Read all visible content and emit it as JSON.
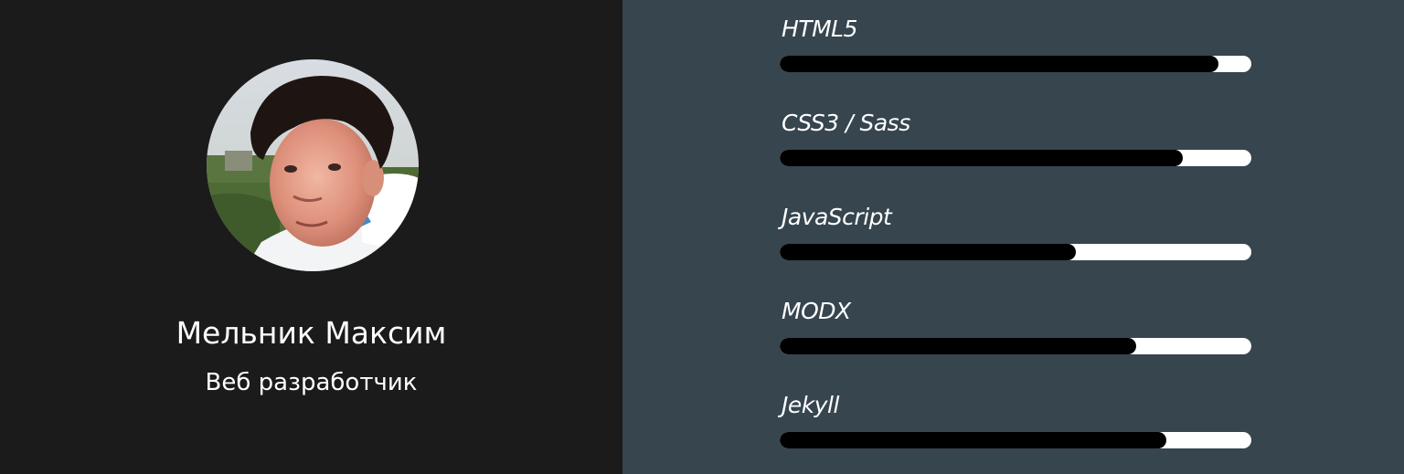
{
  "profile": {
    "name": "Мельник Максим",
    "role": "Веб разработчик",
    "avatar_alt": "portrait photo"
  },
  "skills": [
    {
      "label": "HTML5",
      "level": 0.93
    },
    {
      "label": "CSS3 / Sass",
      "level": 0.855
    },
    {
      "label": "JavaScript",
      "level": 0.628
    },
    {
      "label": "MODX",
      "level": 0.755
    },
    {
      "label": "Jekyll",
      "level": 0.82
    }
  ],
  "colors": {
    "left_bg": "#1b1b1b",
    "right_bg": "#36454e",
    "bar_fill": "#000000",
    "bar_track": "#ffffff",
    "text": "#ffffff"
  }
}
